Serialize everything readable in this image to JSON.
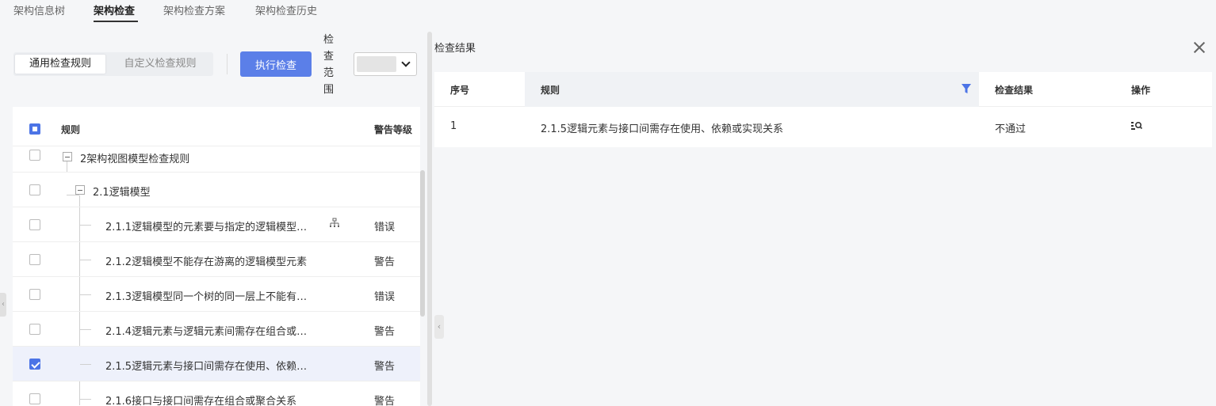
{
  "tabs": [
    {
      "label": "架构信息树",
      "active": false
    },
    {
      "label": "架构检查",
      "active": true
    },
    {
      "label": "架构检查方案",
      "active": false
    },
    {
      "label": "架构检查历史",
      "active": false
    }
  ],
  "toolbar": {
    "segment": {
      "general": "通用检查规则",
      "custom": "自定义检查规则",
      "selected": "通用检查规则"
    },
    "run_label": "执行检查",
    "scope_label": "检查范围"
  },
  "rules_table": {
    "headers": {
      "rule": "规则",
      "level": "警告等级"
    },
    "rows": [
      {
        "label": "2架构视图模型检查规则",
        "level": "",
        "checked": false,
        "depth": 0,
        "expandable": true
      },
      {
        "label": "2.1逻辑模型",
        "level": "",
        "checked": false,
        "depth": 1,
        "expandable": true
      },
      {
        "label": "2.1.1逻辑模型的元素要与指定的逻辑模型…",
        "level": "错误",
        "checked": false,
        "depth": 2,
        "icon": "tree-structure-icon"
      },
      {
        "label": "2.1.2逻辑模型不能存在游离的逻辑模型元素",
        "level": "警告",
        "checked": false,
        "depth": 2
      },
      {
        "label": "2.1.3逻辑模型同一个树的同一层上不能有…",
        "level": "错误",
        "checked": false,
        "depth": 2
      },
      {
        "label": "2.1.4逻辑元素与逻辑元素间需存在组合或…",
        "level": "警告",
        "checked": false,
        "depth": 2
      },
      {
        "label": "2.1.5逻辑元素与接口间需存在使用、依赖…",
        "level": "警告",
        "checked": true,
        "depth": 2,
        "selected": true
      },
      {
        "label": "2.1.6接口与接口间需存在组合或聚合关系",
        "level": "警告",
        "checked": false,
        "depth": 2
      }
    ]
  },
  "results": {
    "title": "检查结果",
    "headers": {
      "index": "序号",
      "rule": "规则",
      "result": "检查结果",
      "action": "操作"
    },
    "rows": [
      {
        "index": "1",
        "rule": "2.1.5逻辑元素与接口间需存在使用、依赖或实现关系",
        "result": "不通过",
        "action_icon": "view-detail-icon"
      }
    ]
  },
  "colors": {
    "primary": "#5b7fe8",
    "checkbox": "#4c74e6",
    "selected_row": "#eef1fb"
  }
}
